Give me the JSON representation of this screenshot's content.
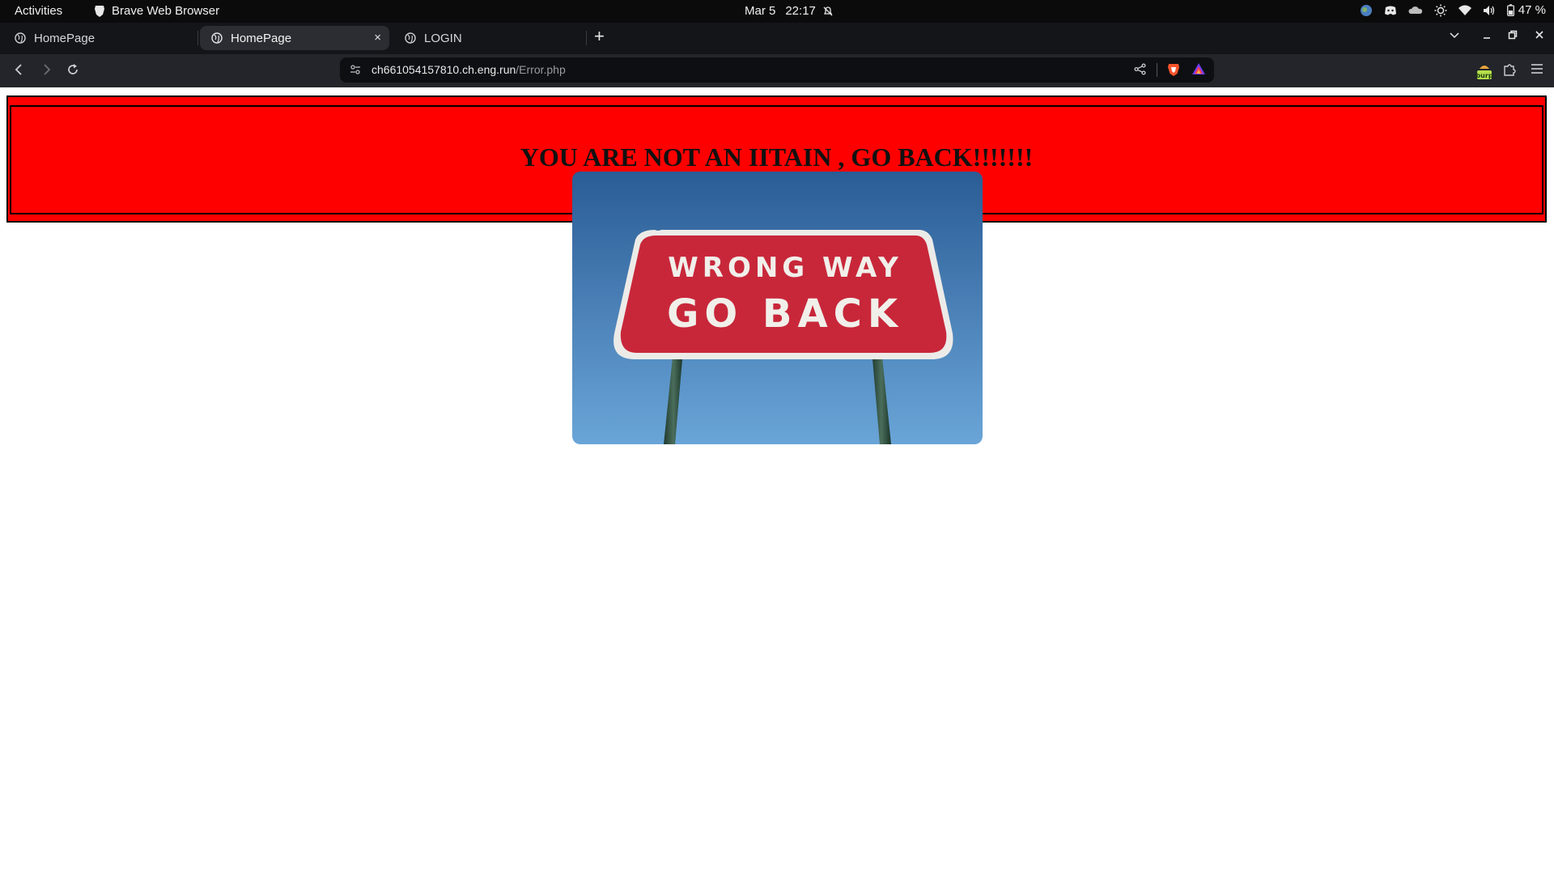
{
  "topbar": {
    "activities": "Activities",
    "app_name": "Brave Web Browser",
    "date": "Mar 5",
    "time": "22:17",
    "battery": "47 %"
  },
  "tabs": [
    {
      "label": "HomePage"
    },
    {
      "label": "HomePage",
      "close": "×"
    },
    {
      "label": "LOGIN"
    }
  ],
  "newtab": "+",
  "address": {
    "host": "ch661054157810.ch.eng.run",
    "path": "/Error.php"
  },
  "page": {
    "banner_text": "YOU ARE NOT AN IITAIN , GO BACK!!!!!!!",
    "sign": {
      "line1": "WRONG WAY",
      "line2": "GO BACK"
    }
  },
  "colors": {
    "banner_bg": "#ff0000",
    "sign_red": "#c8273a",
    "sky_top": "#2a5c95",
    "sky_bottom": "#5e9bd2"
  }
}
